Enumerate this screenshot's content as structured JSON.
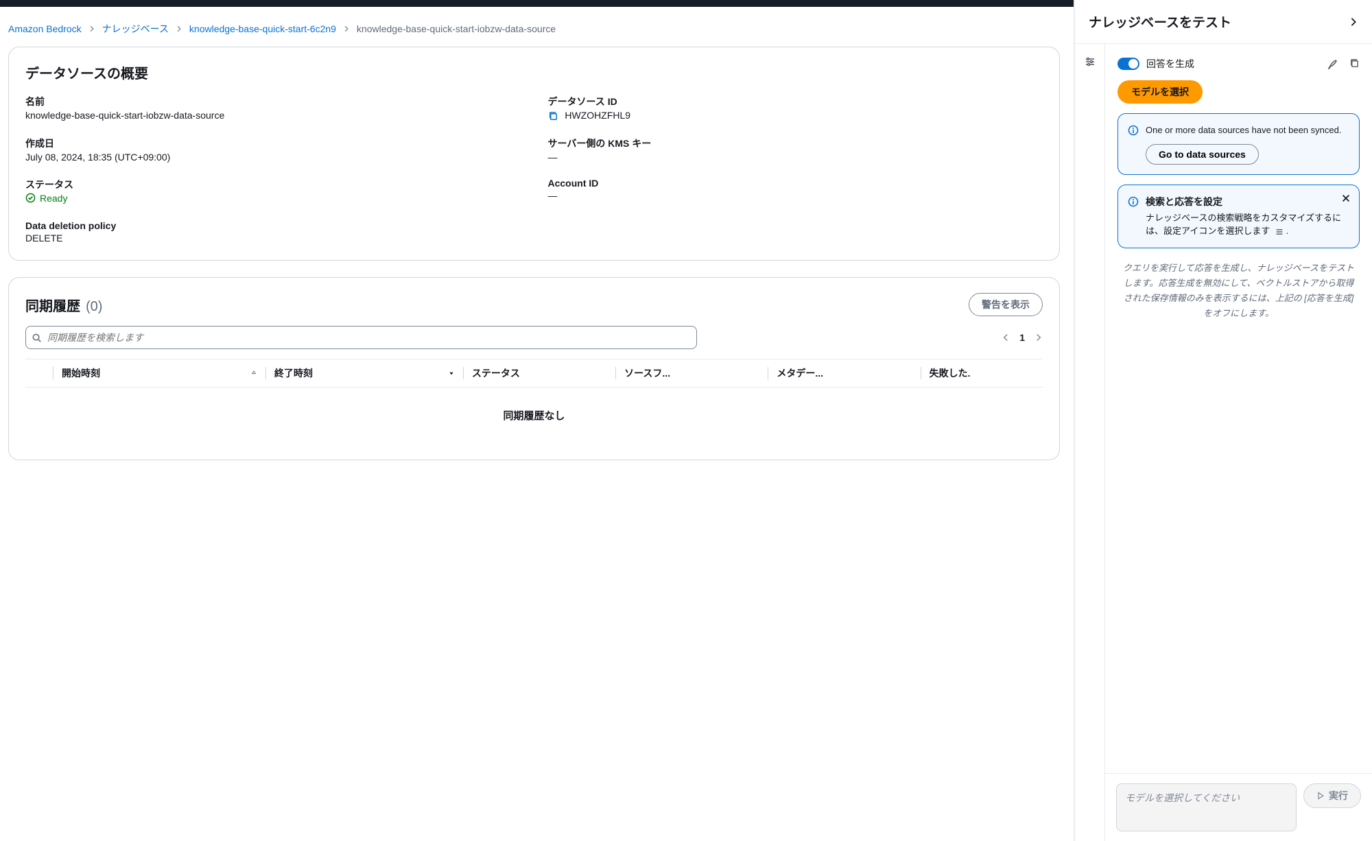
{
  "breadcrumbs": {
    "items": [
      {
        "label": "Amazon Bedrock"
      },
      {
        "label": "ナレッジベース"
      },
      {
        "label": "knowledge-base-quick-start-6c2n9"
      }
    ],
    "current": "knowledge-base-quick-start-iobzw-data-source"
  },
  "overview": {
    "title": "データソースの概要",
    "name_label": "名前",
    "name_value": "knowledge-base-quick-start-iobzw-data-source",
    "id_label": "データソース ID",
    "id_value": "HWZOHZFHL9",
    "created_label": "作成日",
    "created_value": "July 08, 2024, 18:35 (UTC+09:00)",
    "kms_label": "サーバー側の KMS キー",
    "kms_value": "—",
    "status_label": "ステータス",
    "status_value": "Ready",
    "account_label": "Account ID",
    "account_value": "—",
    "deletion_label": "Data deletion policy",
    "deletion_value": "DELETE"
  },
  "sync": {
    "title": "同期履歴",
    "count": "(0)",
    "warnings_button": "警告を表示",
    "search_placeholder": "同期履歴を検索します",
    "page": "1",
    "columns": {
      "start": "開始時刻",
      "end": "終了時刻",
      "status": "ステータス",
      "source": "ソースフ...",
      "meta": "メタデー...",
      "failed": "失敗した."
    },
    "empty": "同期履歴なし"
  },
  "test": {
    "header": "ナレッジベースをテスト",
    "generate_label": "回答を生成",
    "select_model": "モデルを選択",
    "sync_warning": {
      "text": "One or more data sources have not been synced.",
      "button": "Go to data sources"
    },
    "config": {
      "title": "検索と応答を設定",
      "body": "ナレッジベースの検索戦略をカスタマイズするには、設定アイコンを選択します"
    },
    "hint": "クエリを実行して応答を生成し、ナレッジベースをテストします。応答生成を無効にして、ベクトルストアから取得された保存情報のみを表示するには、上記の [応答を生成] をオフにします。",
    "input_placeholder": "モデルを選択してください",
    "run_button": "実行"
  }
}
